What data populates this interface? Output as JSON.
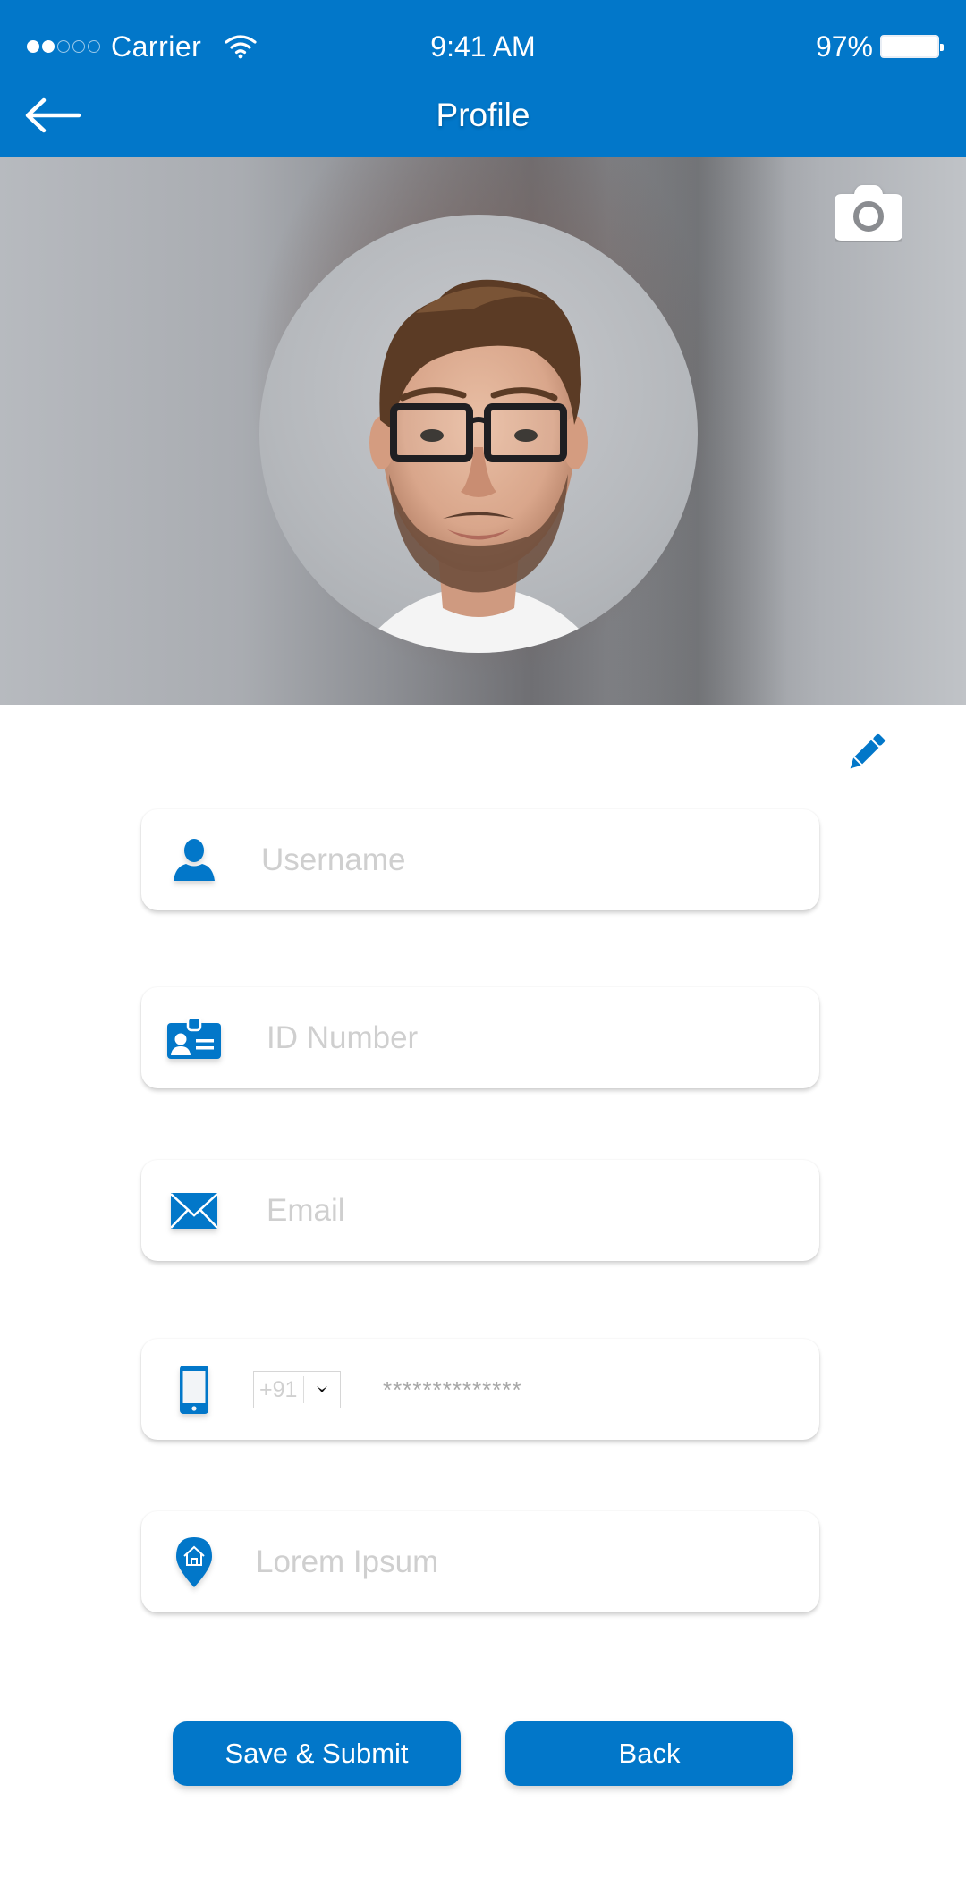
{
  "status_bar": {
    "signal_filled": 2,
    "signal_total": 5,
    "carrier": "Carrier",
    "time": "9:41 AM",
    "battery_percent": "97%"
  },
  "nav": {
    "back_icon": "arrow-left-icon",
    "title": "Profile"
  },
  "hero": {
    "camera_icon": "camera-icon",
    "avatar_alt": "Profile photo of a smiling man with glasses"
  },
  "form": {
    "edit_icon": "pencil-icon",
    "fields": [
      {
        "icon": "user-icon",
        "placeholder": "Username",
        "value": ""
      },
      {
        "icon": "id-card-icon",
        "placeholder": "ID Number",
        "value": ""
      },
      {
        "icon": "envelope-icon",
        "placeholder": "Email",
        "value": ""
      },
      {
        "icon": "mobile-phone-icon",
        "country_code": "+91",
        "value": "**************"
      },
      {
        "icon": "location-home-pin-icon",
        "placeholder": "Lorem Ipsum",
        "value": ""
      }
    ]
  },
  "actions": {
    "save_label": "Save & Submit",
    "back_label": "Back"
  },
  "colors": {
    "primary": "#0277C9",
    "placeholder": "#CFCFCF"
  }
}
